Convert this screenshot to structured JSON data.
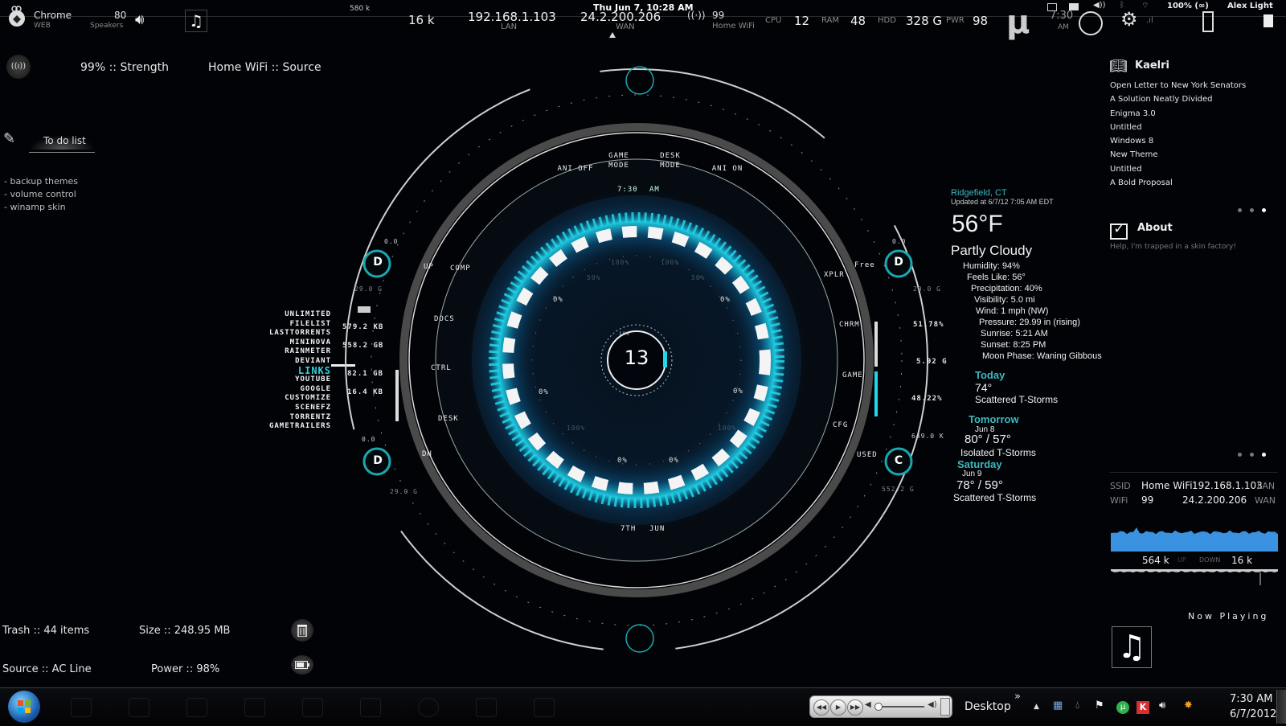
{
  "topbar": {
    "chrome_label": "Chrome",
    "chrome_sub": "WEB",
    "speakers_value": "80",
    "speakers_label": "Speakers",
    "net_up_small": "580 k",
    "net_down": "16 k",
    "lan_ip": "192.168.1.103",
    "lan_label": "LAN",
    "datetime": "Thu Jun  7, 10:28 AM",
    "wan_ip": "24.2.200.206",
    "wan_label": "WAN",
    "wifi_value": "99",
    "wifi_label": "Home WiFi",
    "cpu_label": "CPU",
    "cpu_value": "12",
    "ram_label": "RAM",
    "ram_value": "48",
    "hdd_label": "HDD",
    "hdd_value": "328 G",
    "pwr_label": "PWR",
    "pwr_value": "98",
    "clock_time": "7:30",
    "clock_ampm": "AM",
    "battery_status": "100% (∞)",
    "user_name": "Alex Light"
  },
  "wifi_widget": {
    "strength": "99% :: Strength",
    "source": "Home WiFi  ::  Source"
  },
  "todo": {
    "title": "To do list",
    "items": [
      "- backup themes",
      "- volume control",
      "- winamp skin"
    ]
  },
  "links": {
    "top": [
      "UNLIMITED",
      "FILELIST",
      "LASTTORRENTS",
      "MININOVA",
      "RAINMETER",
      "DEVIANT"
    ],
    "header": "LINKS",
    "bottom": [
      "YOUTUBE",
      "GOOGLE",
      "CUSTOMIZE",
      "SCENEFZ",
      "TORRENTZ",
      "GAMETRAILERS"
    ]
  },
  "hud": {
    "left_stats": [
      "579.2 KB",
      "558.2 GB",
      "82.1 GB",
      "16.4 KB"
    ],
    "drive_top_left": {
      "letter": "D",
      "top": "0.0",
      "bottom": "29.0 G"
    },
    "drive_bottom_left": {
      "letter": "D",
      "top": "0.0",
      "bottom": "29.0 G"
    },
    "drive_top_right": {
      "letter": "D",
      "top": "0.0",
      "bottom": "29.0 G"
    },
    "drive_bottom_right": {
      "letter": "C",
      "top": "649.0 K",
      "bottom": "552.2 G"
    },
    "right_stats": [
      "51.78%",
      "5.92 G",
      "48.22%"
    ],
    "left_labels": {
      "up": "UP",
      "dn": "DN"
    },
    "right_labels": {
      "free": "Free",
      "used": "USED"
    },
    "top_buttons": [
      "ANI OFF",
      "GAME\nMODE",
      "DESK\nMODE",
      "ANI ON"
    ],
    "left_buttons": [
      "COMP",
      "DOCS",
      "CTRL",
      "DESK"
    ],
    "right_buttons": [
      "XPLR",
      "CHRM",
      "GAME",
      "CFG"
    ],
    "time": "7:30",
    "ampm": "AM",
    "day": "7TH",
    "month": "JUN",
    "center_number": "13",
    "center_scale": "100",
    "gauge_labels": [
      "0%",
      "50%",
      "100%"
    ]
  },
  "weather": {
    "location": "Ridgefield, CT",
    "updated": "Updated at 6/7/12 7:05 AM EDT",
    "temp": "56°F",
    "condition": "Partly Cloudy",
    "details": [
      "Humidity: 94%",
      "Feels Like: 56°",
      "Precipitation: 40%",
      "Visibility: 5.0 mi",
      "Wind: 1 mph (NW)",
      "Pressure: 29.99 in (rising)",
      "Sunrise: 5:21 AM",
      "Sunset:  8:25 PM",
      "Moon Phase: Waning Gibbous"
    ],
    "forecast": [
      {
        "day": "Today",
        "date": "",
        "temp": "74°",
        "cond": "Scattered T-Storms"
      },
      {
        "day": "Tomorrow",
        "date": "Jun 8",
        "temp": "80° / 57°",
        "cond": "Isolated T-Storms"
      },
      {
        "day": "Saturday",
        "date": "Jun 9",
        "temp": "78° / 59°",
        "cond": "Scattered T-Storms"
      }
    ]
  },
  "kaelri": {
    "title": "Kaelri",
    "items": [
      "Open Letter to New York Senators",
      "A Solution Neatly Divided",
      "Enigma 3.0",
      "Untitled",
      "Windows 8",
      "New Theme",
      "Untitled",
      "A Bold Proposal"
    ]
  },
  "about": {
    "title": "About",
    "text": "Help, I'm trapped in a skin factory!"
  },
  "network": {
    "ssid_label": "SSID",
    "ssid_value": "Home WiFi",
    "wifi_label": "WiFi",
    "wifi_value": "99",
    "lan_ip": "192.168.1.103",
    "lan_label": "LAN",
    "wan_ip": "24.2.200.206",
    "wan_label": "WAN",
    "up_value": "564 k",
    "up_label": "UP",
    "down_label": "DOWN",
    "down_value": "16 k",
    "graph_color": "#3a92e0"
  },
  "now_playing": {
    "label": "Now Playing"
  },
  "bottom_left": {
    "trash": "Trash :: 44 items",
    "size": "Size :: 248.95 MB",
    "source": "Source :: AC Line",
    "power": "Power :: 98%"
  },
  "taskbar": {
    "desktop_label": "Desktop",
    "chevron": "»",
    "time": "7:30 AM",
    "date": "6/7/2012"
  },
  "colors": {
    "accent": "#22d6e8",
    "teal": "#3cb8c0",
    "bg": "#020307"
  }
}
